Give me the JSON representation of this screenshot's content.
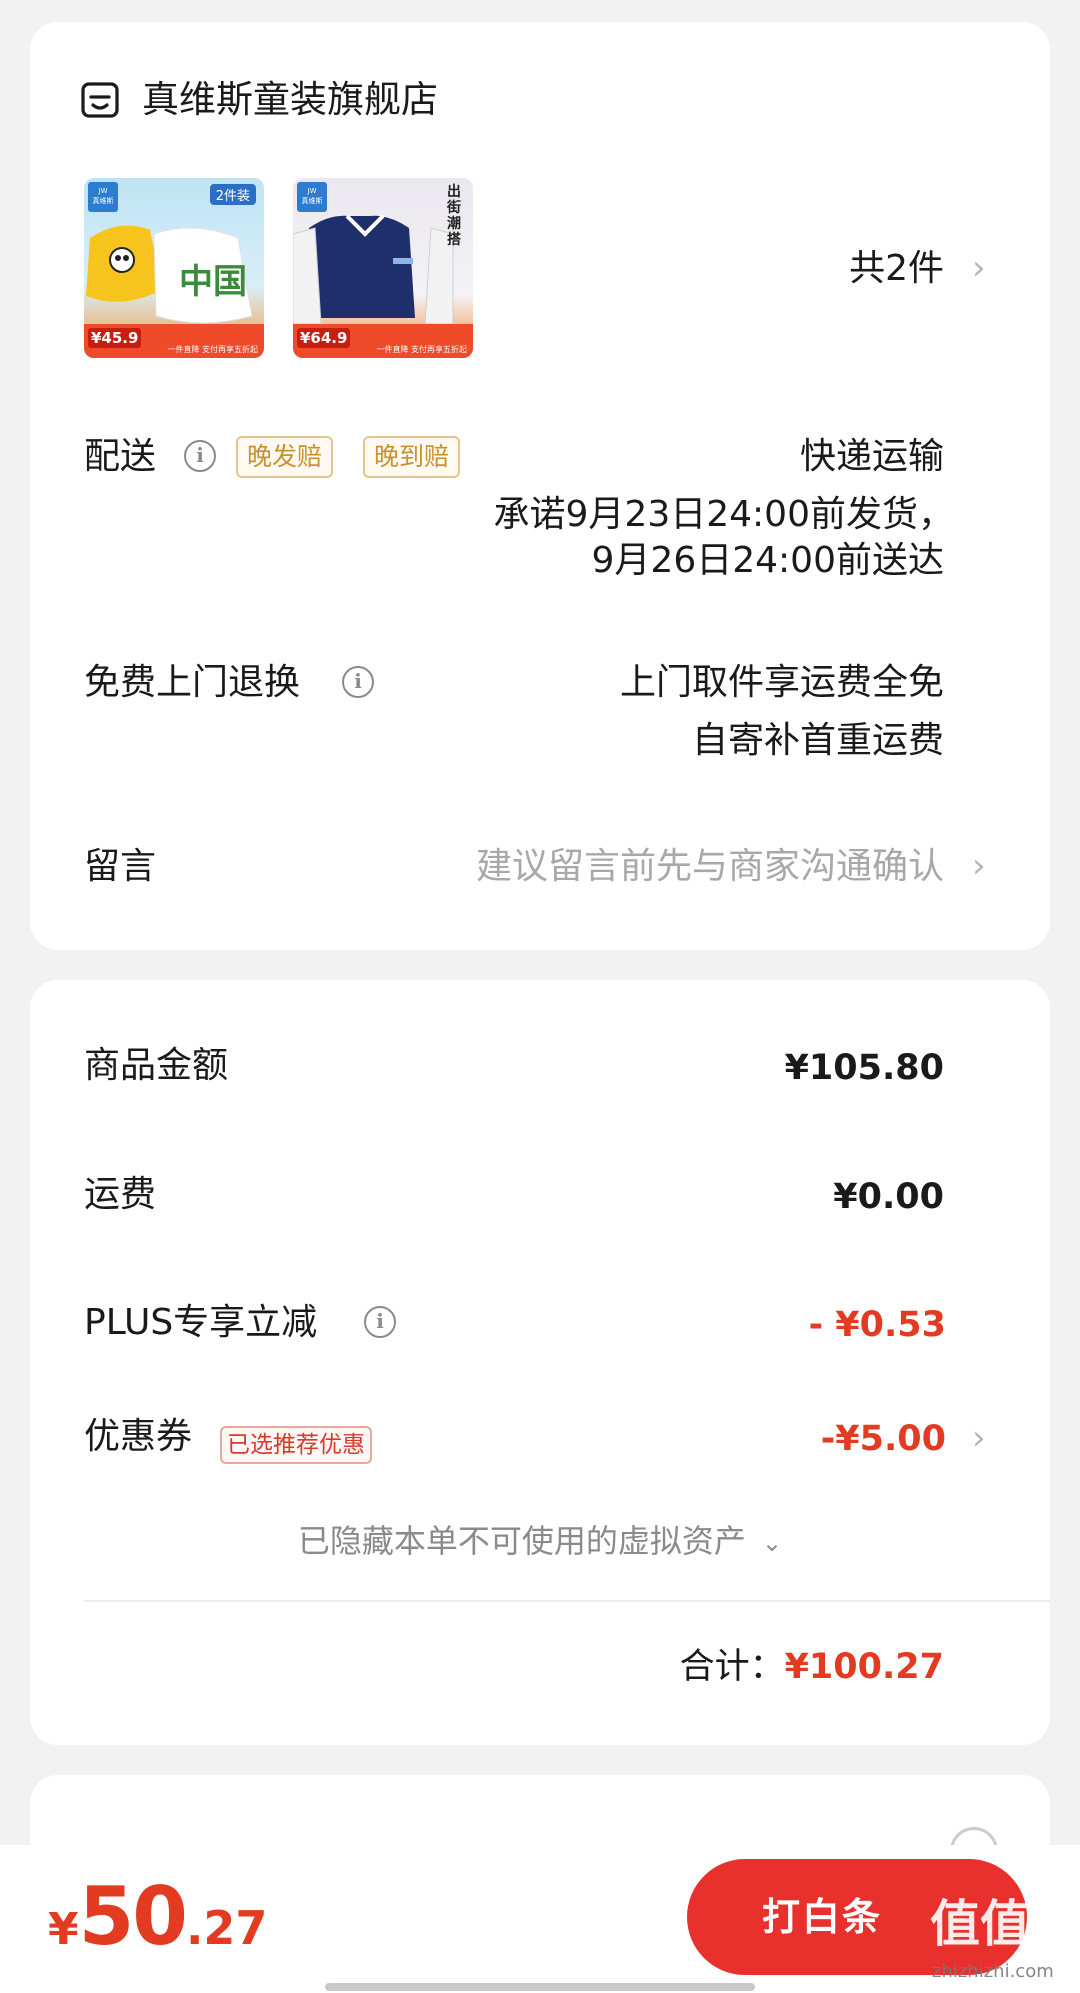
{
  "shop": {
    "name": "真维斯童装旗舰店",
    "count_label": "共2件",
    "products": [
      {
        "tag": "2件装",
        "price": "¥45.9",
        "promo": "一件直降 支付再享五折起"
      },
      {
        "tag": "出街潮搭",
        "price": "¥64.9",
        "promo": "一件直降 支付再享五折起"
      }
    ]
  },
  "delivery": {
    "label": "配送",
    "tags": [
      "晚发赔",
      "晚到赔"
    ],
    "method": "快递运输",
    "promise_line1": "承诺9月23日24:00前发货，",
    "promise_line2": "9月26日24:00前送达"
  },
  "returns": {
    "label": "免费上门退换",
    "line1": "上门取件享运费全免",
    "line2": "自寄补首重运费"
  },
  "message": {
    "label": "留言",
    "placeholder": "建议留言前先与商家沟通确认"
  },
  "pricing": {
    "goods_label": "商品金额",
    "goods_value": "¥105.80",
    "shipping_label": "运费",
    "shipping_value": "¥0.00",
    "plus_label": "PLUS专享立减",
    "plus_value": "- ¥0.53",
    "coupon_label": "优惠券",
    "coupon_tag": "已选推荐优惠",
    "coupon_value": "-¥5.00",
    "hidden_assets": "已隐藏本单不可使用的虚拟资产",
    "total_label": "合计：",
    "total_value": "¥100.27"
  },
  "bottom": {
    "currency": "¥",
    "amount_int": "50",
    "amount_dec": ".27",
    "pay_label": "打白条",
    "watermark": "值\nzhizhizhi.com"
  },
  "colors": {
    "accent_red": "#e33a22",
    "button_red": "#e8302c",
    "tag_gold": "#c8912e"
  }
}
